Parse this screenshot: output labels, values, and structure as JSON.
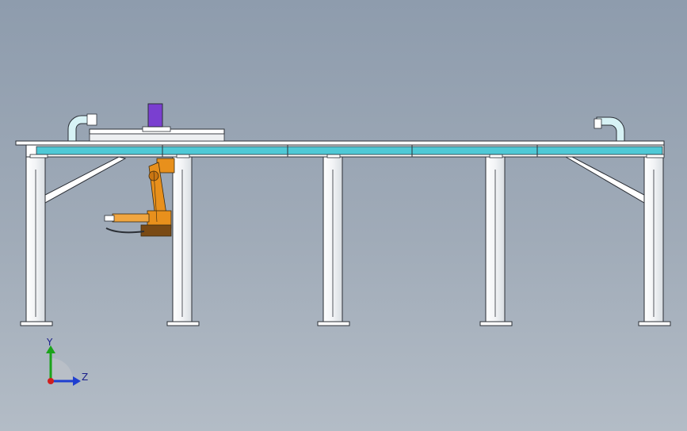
{
  "viewport": {
    "background_top": "#8e9cad",
    "background_bottom": "#b3bcc6"
  },
  "colors": {
    "structure": "#ffffff",
    "outline": "#2b2f36",
    "rail": "#4fc9d6",
    "robot": "#e8901c",
    "marker": "#7a3fd0"
  },
  "triad": {
    "y_label": "Y",
    "z_label": "Z",
    "y_color": "#1aa31a",
    "z_color": "#1f3fd0",
    "x_color": "#d01f1f"
  },
  "icons": [
    "cable-chain-icon",
    "robot-arm-icon",
    "axis-triad-icon"
  ]
}
